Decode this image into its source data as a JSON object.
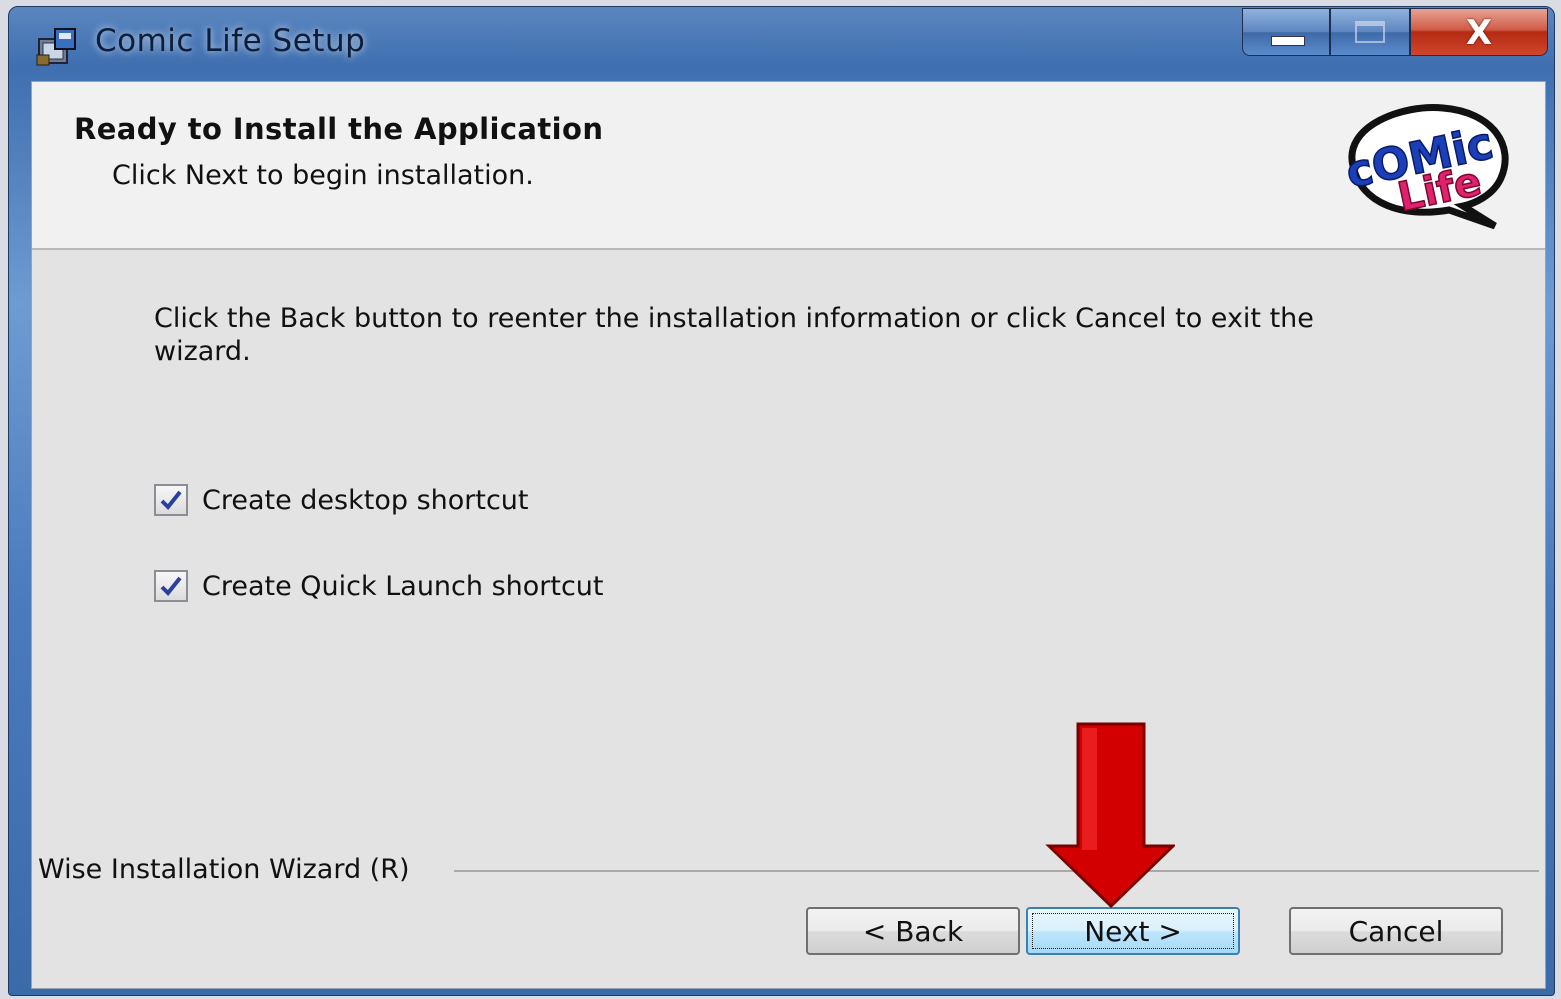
{
  "window": {
    "title": "Comic Life Setup",
    "close_symbol": "X"
  },
  "header": {
    "title": "Ready to Install the Application",
    "subtitle": "Click Next to begin installation.",
    "logo_text": "COMIC Life"
  },
  "body": {
    "instructions": "Click the Back button to reenter the installation information or click Cancel to exit the wizard.",
    "checkboxes": [
      {
        "label": "Create desktop shortcut",
        "checked": true
      },
      {
        "label": "Create Quick Launch shortcut",
        "checked": true
      }
    ]
  },
  "footer": {
    "brand": "Wise Installation Wizard (R)",
    "back_label": "< Back",
    "next_label": "Next >",
    "cancel_label": "Cancel"
  },
  "colors": {
    "annotation_arrow": "#d20000",
    "titlebar": "#4a7bbd",
    "close_button": "#c8422a"
  }
}
